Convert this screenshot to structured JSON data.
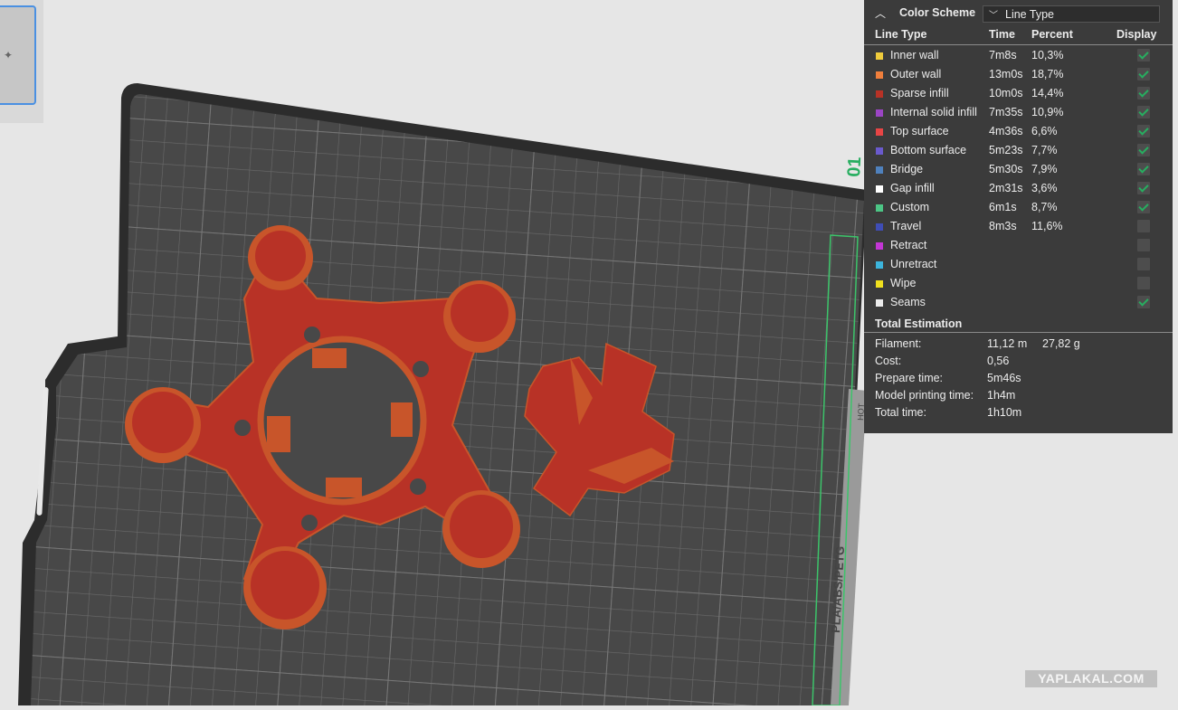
{
  "color_scheme": {
    "title": "Color Scheme",
    "selected": "Line Type"
  },
  "columns": {
    "line_type": "Line Type",
    "time": "Time",
    "percent": "Percent",
    "display": "Display"
  },
  "line_types": [
    {
      "name": "Inner wall",
      "time": "7m8s",
      "percent": "10,3%",
      "color": "#f0cc3c",
      "display": true
    },
    {
      "name": "Outer wall",
      "time": "13m0s",
      "percent": "18,7%",
      "color": "#f07f3c",
      "display": true
    },
    {
      "name": "Sparse infill",
      "time": "10m0s",
      "percent": "14,4%",
      "color": "#b83226",
      "display": true
    },
    {
      "name": "Internal solid infill",
      "time": "7m35s",
      "percent": "10,9%",
      "color": "#9b45c4",
      "display": true
    },
    {
      "name": "Top surface",
      "time": "4m36s",
      "percent": "6,6%",
      "color": "#e84545",
      "display": true
    },
    {
      "name": "Bottom surface",
      "time": "5m23s",
      "percent": "7,7%",
      "color": "#6a5acd",
      "display": true
    },
    {
      "name": "Bridge",
      "time": "5m30s",
      "percent": "7,9%",
      "color": "#4f81bd",
      "display": true
    },
    {
      "name": "Gap infill",
      "time": "2m31s",
      "percent": "3,6%",
      "color": "#ffffff",
      "display": true
    },
    {
      "name": "Custom",
      "time": "6m1s",
      "percent": "8,7%",
      "color": "#4cc585",
      "display": true
    },
    {
      "name": "Travel",
      "time": "8m3s",
      "percent": "11,6%",
      "color": "#3f4db5",
      "display": false
    },
    {
      "name": "Retract",
      "time": "",
      "percent": "",
      "color": "#c436d6",
      "display": false
    },
    {
      "name": "Unretract",
      "time": "",
      "percent": "",
      "color": "#3cb4dc",
      "display": false
    },
    {
      "name": "Wipe",
      "time": "",
      "percent": "",
      "color": "#f0e01e",
      "display": false
    },
    {
      "name": "Seams",
      "time": "",
      "percent": "",
      "color": "#ececec",
      "display": true
    }
  ],
  "total_estimation": {
    "title": "Total Estimation",
    "rows": [
      {
        "label": "Filament:",
        "value": "11,12 m",
        "value2": "27,82 g"
      },
      {
        "label": "Cost:",
        "value": "0,56",
        "value2": ""
      },
      {
        "label": "Prepare time:",
        "value": "5m46s",
        "value2": ""
      },
      {
        "label": "Model printing time:",
        "value": "1h4m",
        "value2": ""
      },
      {
        "label": "Total time:",
        "value": "1h10m",
        "value2": ""
      }
    ]
  },
  "plate": {
    "number": "01",
    "side_label": "PLA/ABS/PETG",
    "hot_label": "HOT"
  },
  "watermark": "YAPLAKAL.COM"
}
